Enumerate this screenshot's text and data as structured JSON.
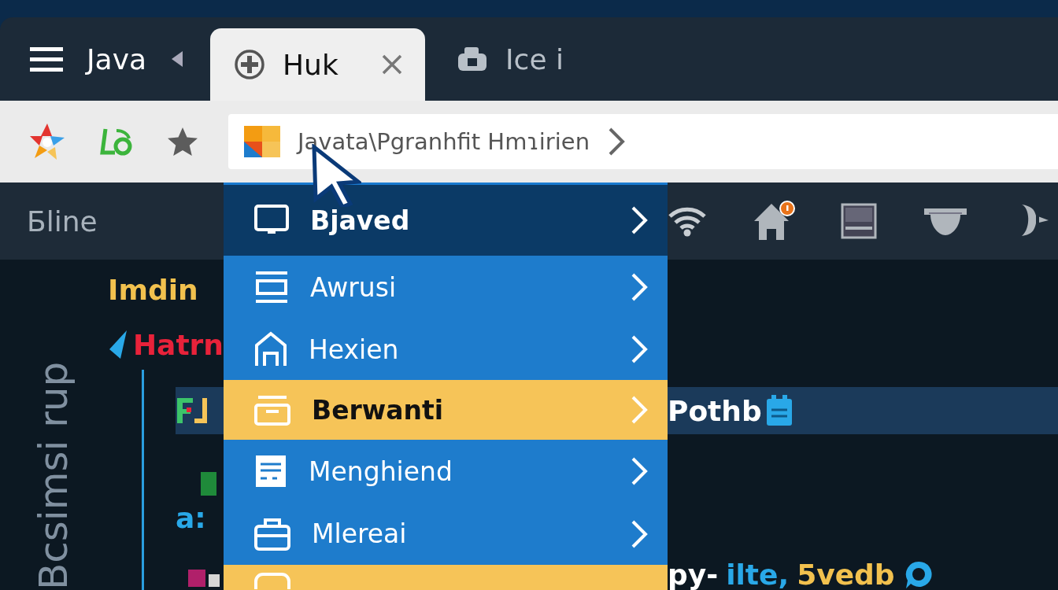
{
  "app_title": "Java",
  "tabs": [
    {
      "label": "Huk",
      "selected": true
    },
    {
      "label": "Ice i",
      "selected": false
    }
  ],
  "address_bar": {
    "value": "Javata\\Pgranhfit Hmɿirien"
  },
  "panel_title": "Бline",
  "menu": [
    {
      "label": "Bjaved",
      "hovered": true,
      "highlighted": false
    },
    {
      "label": "Awrusi",
      "hovered": false,
      "highlighted": false
    },
    {
      "label": "Hexien",
      "hovered": false,
      "highlighted": false
    },
    {
      "label": "Berwanti",
      "hovered": false,
      "highlighted": true
    },
    {
      "label": "Menghiend",
      "hovered": false,
      "highlighted": false
    },
    {
      "label": "Mlereai",
      "hovered": false,
      "highlighted": false
    },
    {
      "hovered": false,
      "highlighted": true
    }
  ],
  "side_label": "Bcsimsi rup",
  "code_left": [
    {
      "text": "Imdin",
      "color": "#f2c14e"
    },
    {
      "text": "Hatrn",
      "color": "#e8223a"
    }
  ],
  "left_fragment": {
    "text": "a:",
    "color": "#29a8e8"
  },
  "highlighted_line": "Pothb",
  "bottom_line": [
    {
      "text": "py-",
      "color": "#ffffff"
    },
    {
      "text": "ilte,",
      "color": "#29a8e8"
    },
    {
      "text": "5vedb",
      "color": "#f2c14e"
    }
  ]
}
